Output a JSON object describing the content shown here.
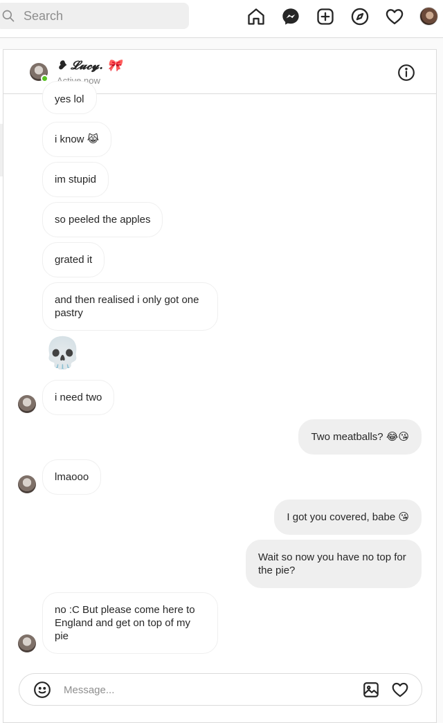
{
  "search": {
    "placeholder": "Search"
  },
  "nav": {
    "icons": [
      "home-icon",
      "messenger-icon",
      "new-post-icon",
      "explore-icon",
      "activity-heart-icon",
      "profile-avatar"
    ]
  },
  "chat": {
    "contact_name": "❥ 𝓛𝓾𝓬𝔂. 🎀",
    "status": "Active now"
  },
  "messages": [
    {
      "side": "in",
      "text": "yes lol"
    },
    {
      "side": "in",
      "text": "i know 😹"
    },
    {
      "side": "in",
      "text": "im stupid"
    },
    {
      "side": "in",
      "text": "so peeled the apples"
    },
    {
      "side": "in",
      "text": "grated it"
    },
    {
      "side": "in",
      "text": "and then realised i only got one pastry"
    },
    {
      "side": "in",
      "text": "💀"
    },
    {
      "side": "in",
      "text": "i need two"
    },
    {
      "side": "out",
      "text": "Two meatballs? 😂😘"
    },
    {
      "side": "in",
      "text": "lmaooo"
    },
    {
      "side": "out",
      "text": "I got you covered, babe 😘"
    },
    {
      "side": "out",
      "text": "Wait so now you have no top for the pie?"
    },
    {
      "side": "in",
      "text": "no :C But please come here to England and get on top of my pie"
    }
  ],
  "composer": {
    "placeholder": "Message..."
  },
  "colors": {
    "bubble_out": "#efefef",
    "online": "#58c322",
    "border": "#dbdbdb",
    "muted_text": "#8e8e8e"
  }
}
